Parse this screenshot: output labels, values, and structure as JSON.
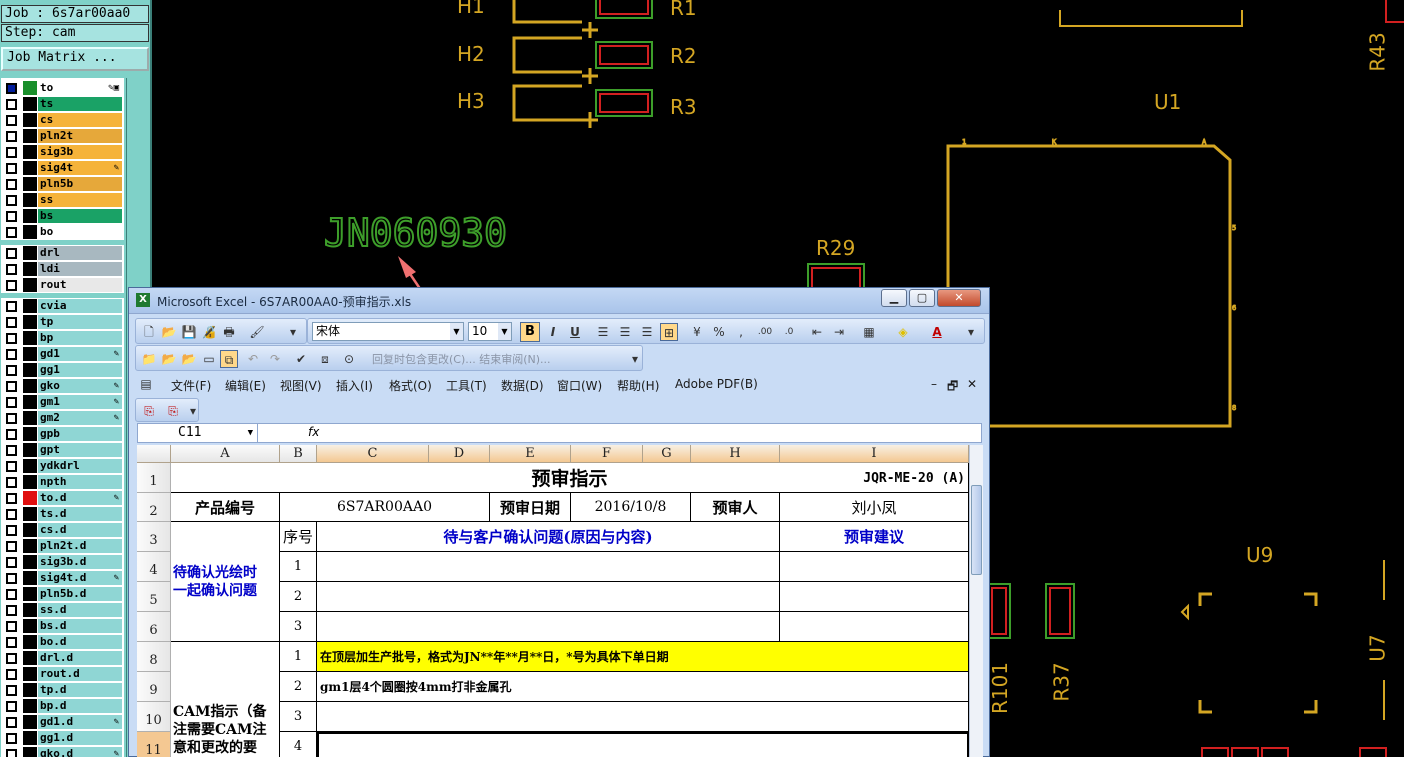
{
  "cam": {
    "job": "Job : 6s7ar00aa0",
    "step": "Step: cam",
    "job_matrix_button": "Job Matrix ...",
    "layers": [
      {
        "name": "to",
        "color": "#ffffff",
        "checked": true,
        "swatch": "#1a8f2c",
        "edit": "✎▣"
      },
      {
        "name": "ts",
        "color": "#1aa266",
        "checked": false,
        "swatch": "#000000",
        "edit": ""
      },
      {
        "name": "cs",
        "color": "#f5b33a",
        "checked": false,
        "swatch": "#000000",
        "edit": ""
      },
      {
        "name": "pln2t",
        "color": "#e6a83a",
        "checked": false,
        "swatch": "#000000",
        "edit": ""
      },
      {
        "name": "sig3b",
        "color": "#f5b33a",
        "checked": false,
        "swatch": "#000000",
        "edit": ""
      },
      {
        "name": "sig4t",
        "color": "#f5b33a",
        "checked": false,
        "swatch": "#000000",
        "edit": "✎"
      },
      {
        "name": "pln5b",
        "color": "#e6a83a",
        "checked": false,
        "swatch": "#000000",
        "edit": ""
      },
      {
        "name": "ss",
        "color": "#f5b33a",
        "checked": false,
        "swatch": "#000000",
        "edit": ""
      },
      {
        "name": "bs",
        "color": "#1aa266",
        "checked": false,
        "swatch": "#000000",
        "edit": ""
      },
      {
        "name": "bo",
        "color": "#ffffff",
        "checked": false,
        "swatch": "#000000",
        "edit": ""
      },
      {
        "name": "drl",
        "color": "#a8b8c0",
        "checked": false,
        "swatch": "#000000",
        "edit": ""
      },
      {
        "name": "ldi",
        "color": "#a8b8c0",
        "checked": false,
        "swatch": "#000000",
        "edit": ""
      },
      {
        "name": "rout",
        "color": "#e8e8e8",
        "checked": false,
        "swatch": "#000000",
        "edit": ""
      },
      {
        "name": "cvia",
        "color": "#8fd6d4",
        "checked": false,
        "swatch": "#000000",
        "edit": ""
      },
      {
        "name": "tp",
        "color": "#8fd6d4",
        "checked": false,
        "swatch": "#000000",
        "edit": ""
      },
      {
        "name": "bp",
        "color": "#8fd6d4",
        "checked": false,
        "swatch": "#000000",
        "edit": ""
      },
      {
        "name": "gd1",
        "color": "#8fd6d4",
        "checked": false,
        "swatch": "#000000",
        "edit": "✎"
      },
      {
        "name": "gg1",
        "color": "#8fd6d4",
        "checked": false,
        "swatch": "#000000",
        "edit": ""
      },
      {
        "name": "gko",
        "color": "#8fd6d4",
        "checked": false,
        "swatch": "#000000",
        "edit": "✎"
      },
      {
        "name": "gm1",
        "color": "#8fd6d4",
        "checked": false,
        "swatch": "#000000",
        "edit": "✎"
      },
      {
        "name": "gm2",
        "color": "#8fd6d4",
        "checked": false,
        "swatch": "#000000",
        "edit": "✎"
      },
      {
        "name": "gpb",
        "color": "#8fd6d4",
        "checked": false,
        "swatch": "#000000",
        "edit": ""
      },
      {
        "name": "gpt",
        "color": "#8fd6d4",
        "checked": false,
        "swatch": "#000000",
        "edit": ""
      },
      {
        "name": "ydkdrl",
        "color": "#8fd6d4",
        "checked": false,
        "swatch": "#000000",
        "edit": ""
      },
      {
        "name": "npth",
        "color": "#8fd6d4",
        "checked": false,
        "swatch": "#000000",
        "edit": ""
      },
      {
        "name": "to.d",
        "color": "#8fd6d4",
        "checked": false,
        "swatch": "#e01010",
        "edit": "✎"
      },
      {
        "name": "ts.d",
        "color": "#8fd6d4",
        "checked": false,
        "swatch": "#000000",
        "edit": ""
      },
      {
        "name": "cs.d",
        "color": "#8fd6d4",
        "checked": false,
        "swatch": "#000000",
        "edit": ""
      },
      {
        "name": "pln2t.d",
        "color": "#8fd6d4",
        "checked": false,
        "swatch": "#000000",
        "edit": ""
      },
      {
        "name": "sig3b.d",
        "color": "#8fd6d4",
        "checked": false,
        "swatch": "#000000",
        "edit": ""
      },
      {
        "name": "sig4t.d",
        "color": "#8fd6d4",
        "checked": false,
        "swatch": "#000000",
        "edit": "✎"
      },
      {
        "name": "pln5b.d",
        "color": "#8fd6d4",
        "checked": false,
        "swatch": "#000000",
        "edit": ""
      },
      {
        "name": "ss.d",
        "color": "#8fd6d4",
        "checked": false,
        "swatch": "#000000",
        "edit": ""
      },
      {
        "name": "bs.d",
        "color": "#8fd6d4",
        "checked": false,
        "swatch": "#000000",
        "edit": ""
      },
      {
        "name": "bo.d",
        "color": "#8fd6d4",
        "checked": false,
        "swatch": "#000000",
        "edit": ""
      },
      {
        "name": "drl.d",
        "color": "#8fd6d4",
        "checked": false,
        "swatch": "#000000",
        "edit": ""
      },
      {
        "name": "rout.d",
        "color": "#8fd6d4",
        "checked": false,
        "swatch": "#000000",
        "edit": ""
      },
      {
        "name": "tp.d",
        "color": "#8fd6d4",
        "checked": false,
        "swatch": "#000000",
        "edit": ""
      },
      {
        "name": "bp.d",
        "color": "#8fd6d4",
        "checked": false,
        "swatch": "#000000",
        "edit": ""
      },
      {
        "name": "gd1.d",
        "color": "#8fd6d4",
        "checked": false,
        "swatch": "#000000",
        "edit": "✎"
      },
      {
        "name": "gg1.d",
        "color": "#8fd6d4",
        "checked": false,
        "swatch": "#000000",
        "edit": ""
      },
      {
        "name": "gko.d",
        "color": "#8fd6d4",
        "checked": false,
        "swatch": "#000000",
        "edit": "✎"
      }
    ]
  },
  "pcb": {
    "marking_text": "JN060930",
    "refdes": {
      "h1": "H1",
      "h2": "H2",
      "h3": "H3",
      "r1": "R1",
      "r2": "R2",
      "r3": "R3",
      "u1": "U1",
      "r29": "R29",
      "r43": "R43",
      "u9": "U9",
      "r101": "R101",
      "r37": "R37",
      "u7": "U7"
    },
    "colors": {
      "silk": "#d4a623",
      "pad_outline": "#3d9e2a",
      "pad_red": "#d22020",
      "marking": "#3d9e2a",
      "arrow": "#f07070"
    }
  },
  "excel": {
    "title": "Microsoft Excel - 6S7AR00AA0-预审指示.xls",
    "font_name": "宋体",
    "font_size": "10",
    "toolbar_hint": "回复时包含更改(C)...  结束审阅(N)...",
    "menus": [
      "文件(F)",
      "编辑(E)",
      "视图(V)",
      "插入(I)",
      "格式(O)",
      "工具(T)",
      "数据(D)",
      "窗口(W)",
      "帮助(H)",
      "Adobe PDF(B)"
    ],
    "name_box": "C11",
    "fx": "fx",
    "columns": [
      "A",
      "B",
      "C",
      "D",
      "E",
      "F",
      "G",
      "H",
      "I"
    ],
    "rows": [
      "1",
      "2",
      "3",
      "4",
      "5",
      "6",
      "8",
      "9",
      "10",
      "11"
    ],
    "sheet": {
      "title": "预审指示",
      "doc_code": "JQR-ME-20 (A)",
      "product_label": "产品编号",
      "product_value": "6S7AR00AA0",
      "date_label": "预审日期",
      "date_value": "2016/10/8",
      "reviewer_label": "预审人",
      "reviewer_value": "刘小凤",
      "seq_header": "序号",
      "question_header": "待与客户确认问题(原因与内容)",
      "suggestion_header": "预审建议",
      "group1": "待确认光绘时\n一起确认问题",
      "group2": "CAM指示（备\n注需要CAM注\n意和更改的要",
      "seq": [
        "1",
        "2",
        "3",
        "1",
        "2",
        "3",
        "4"
      ],
      "instr1": "在顶层加生产批号，格式为JN**年**月**日，*号为具体下单日期",
      "instr2": "gm1层4个圆圈按4mm打非金属孔"
    }
  }
}
